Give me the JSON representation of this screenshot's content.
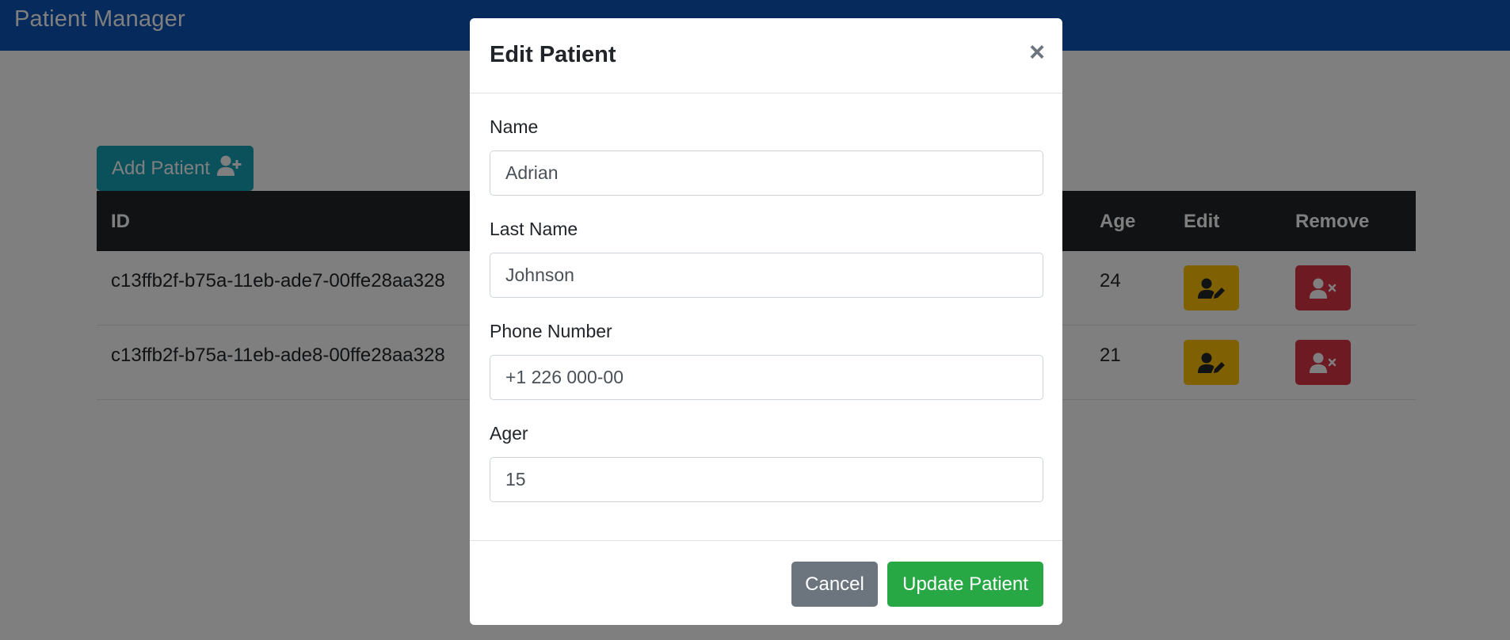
{
  "app": {
    "title": "Patient Manager"
  },
  "toolbar": {
    "add_label": "Add Patient",
    "add_icon": "user-plus-icon"
  },
  "table": {
    "columns": {
      "id": "ID",
      "age": "Age",
      "edit": "Edit",
      "remove": "Remove"
    },
    "rows": [
      {
        "id": "c13ffb2f-b75a-11eb-ade7-00ffe28aa328",
        "age": "24"
      },
      {
        "id": "c13ffb2f-b75a-11eb-ade8-00ffe28aa328",
        "age": "21"
      }
    ],
    "edit_icon": "user-edit-icon",
    "remove_icon": "user-times-icon"
  },
  "modal": {
    "title": "Edit Patient",
    "close_label": "×",
    "fields": {
      "name": {
        "label": "Name",
        "value": "Adrian"
      },
      "last_name": {
        "label": "Last Name",
        "value": "Johnson"
      },
      "phone": {
        "label": "Phone Number",
        "value": "+1 226 000-00"
      },
      "age": {
        "label": "Ager",
        "value": "15"
      }
    },
    "cancel_label": "Cancel",
    "update_label": "Update Patient"
  },
  "colors": {
    "navbar": "#0b55b6",
    "info": "#17a2b8",
    "warning": "#ffc107",
    "danger": "#dc3545",
    "secondary": "#6c757d",
    "success": "#28a745",
    "dark": "#212529"
  }
}
